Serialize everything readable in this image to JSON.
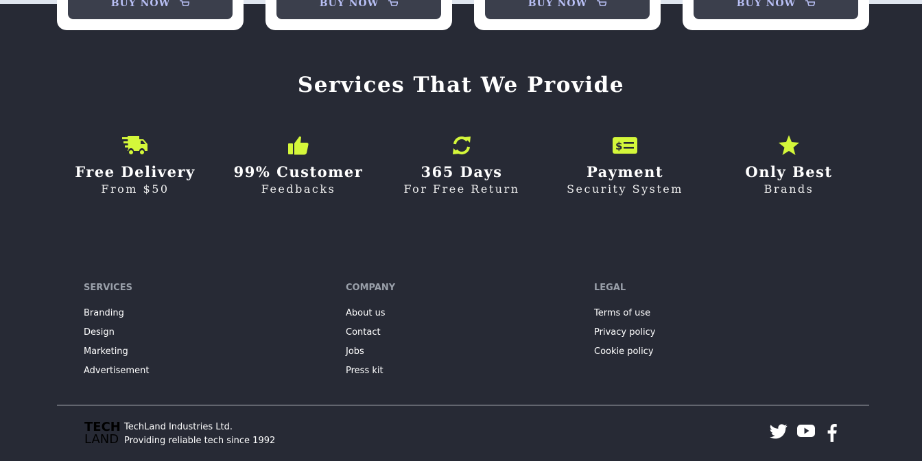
{
  "products": {
    "buy_label": "BUY NOW",
    "cards": [
      {
        "name": "product-card-1"
      },
      {
        "name": "product-card-2"
      },
      {
        "name": "product-card-3"
      },
      {
        "name": "product-card-4"
      }
    ]
  },
  "services": {
    "title": "Services That We Provide",
    "accent_color": "#d4f73a",
    "items": [
      {
        "icon": "truck-delivery-icon",
        "heading": "Free Delivery",
        "sub": "From $50"
      },
      {
        "icon": "thumbs-up-icon",
        "heading": "99% Customer",
        "sub": "Feedbacks"
      },
      {
        "icon": "refresh-icon",
        "heading": "365 Days",
        "sub": "For Free Return"
      },
      {
        "icon": "money-check-icon",
        "heading": "Payment",
        "sub": "Security System"
      },
      {
        "icon": "star-icon",
        "heading": "Only Best",
        "sub": "Brands"
      }
    ]
  },
  "footer": {
    "columns": [
      {
        "heading": "SERVICES",
        "links": [
          "Branding",
          "Design",
          "Marketing",
          "Advertisement"
        ]
      },
      {
        "heading": "COMPANY",
        "links": [
          "About us",
          "Contact",
          "Jobs",
          "Press kit"
        ]
      },
      {
        "heading": "LEGAL",
        "links": [
          "Terms of use",
          "Privacy policy",
          "Cookie policy"
        ]
      }
    ],
    "logo": {
      "line1": "TECH",
      "line2": "LAND"
    },
    "company_name": "TechLand Industries Ltd.",
    "tagline": "Providing reliable tech since 1992",
    "social": [
      "twitter-icon",
      "youtube-icon",
      "facebook-icon"
    ]
  }
}
